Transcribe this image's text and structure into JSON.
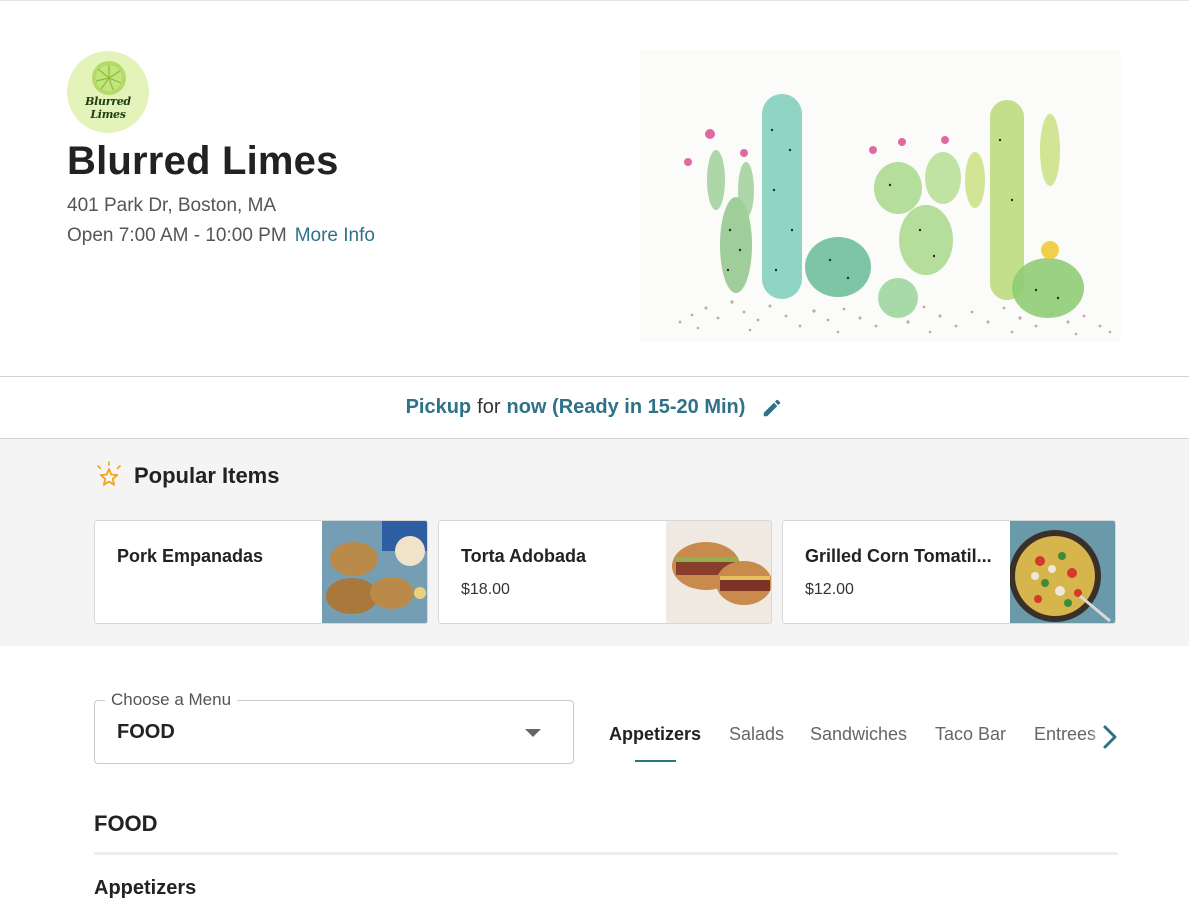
{
  "restaurant": {
    "logo_text": "Blurred Limes",
    "name": "Blurred Limes",
    "address": "401 Park Dr, Boston, MA",
    "hours": "Open 7:00 AM - 10:00 PM",
    "more_info_label": "More Info"
  },
  "pickup": {
    "mode": "Pickup",
    "connector": "for",
    "time": "now (Ready in 15-20 Min)",
    "edit_icon": "pencil-icon"
  },
  "popular": {
    "title": "Popular Items",
    "icon": "star-icon",
    "items": [
      {
        "name": "Pork Empanadas",
        "price": ""
      },
      {
        "name": "Torta Adobada",
        "price": "$18.00"
      },
      {
        "name": "Grilled Corn Tomatil...",
        "price": "$12.00"
      }
    ]
  },
  "menu_selector": {
    "label": "Choose a Menu",
    "value": "FOOD"
  },
  "tabs": {
    "items": [
      "Appetizers",
      "Salads",
      "Sandwiches",
      "Taco Bar",
      "Entrees"
    ],
    "active": "Appetizers",
    "next_icon": "chevron-right-icon"
  },
  "menu": {
    "section_title": "FOOD",
    "category_title": "Appetizers"
  },
  "colors": {
    "accent": "#2f7187",
    "popular_bg": "#f4f4f4",
    "logo_bg": "#e3f3b9",
    "star": "#f2a51a"
  }
}
